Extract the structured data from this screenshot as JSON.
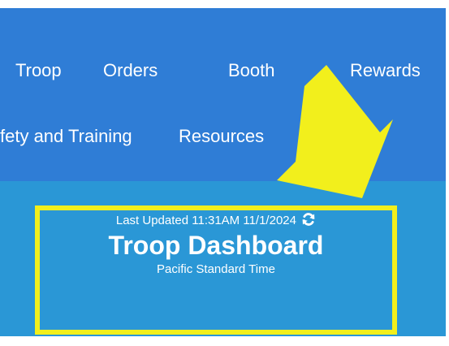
{
  "nav": {
    "items": [
      {
        "label": "Troop"
      },
      {
        "label": "Orders"
      },
      {
        "label": "Booth"
      },
      {
        "label": "Rewards"
      },
      {
        "label": "fety and Training"
      },
      {
        "label": "Resources"
      }
    ]
  },
  "banner": {
    "updated_label": "Last Updated 11:31AM 11/1/2024",
    "title": "Troop Dashboard",
    "timezone": "Pacific Standard Time"
  },
  "colors": {
    "nav_background": "#2f7dd6",
    "banner_background": "#2a97d6",
    "annotation_yellow": "#f2ef1c"
  },
  "icons": {
    "refresh": "refresh-icon",
    "annotation_arrow": "arrow-down-left-icon"
  }
}
